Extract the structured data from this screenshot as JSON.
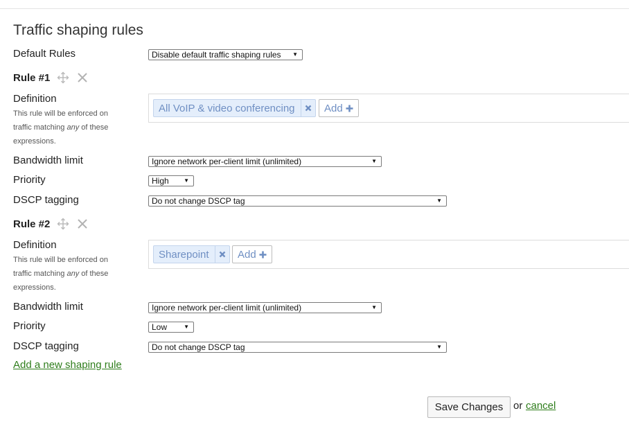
{
  "section": {
    "title": "Traffic shaping rules"
  },
  "default_rules": {
    "label": "Default Rules",
    "selected": "Disable default traffic shaping rules"
  },
  "rules": [
    {
      "title": "Rule #1",
      "definition_label": "Definition",
      "definition_help_pre": "This rule will be enforced on traffic matching ",
      "definition_help_em": "any",
      "definition_help_post": " of these expressions.",
      "tag": "All VoIP & video conferencing",
      "add_label": "Add",
      "bandwidth_label": "Bandwidth limit",
      "bandwidth_value": "Ignore network per-client limit (unlimited)",
      "priority_label": "Priority",
      "priority_value": "High",
      "dscp_label": "DSCP tagging",
      "dscp_value": "Do not change DSCP tag"
    },
    {
      "title": "Rule #2",
      "definition_label": "Definition",
      "definition_help_pre": "This rule will be enforced on traffic matching ",
      "definition_help_em": "any",
      "definition_help_post": " of these expressions.",
      "tag": "Sharepoint",
      "add_label": "Add",
      "bandwidth_label": "Bandwidth limit",
      "bandwidth_value": "Ignore network per-client limit (unlimited)",
      "priority_label": "Priority",
      "priority_value": "Low",
      "dscp_label": "DSCP tagging",
      "dscp_value": "Do not change DSCP tag"
    }
  ],
  "add_rule_link": "Add a new shaping rule",
  "footer": {
    "save_label": "Save Changes",
    "or_text": "or",
    "cancel_label": "cancel"
  },
  "icons": {
    "move": "move-arrows-icon",
    "delete": "close-x-icon",
    "tag_remove": "remove-tag-icon",
    "add": "plus-icon"
  },
  "colors": {
    "link_green": "#2e7d1b",
    "tag_blue": "#6f8fc3",
    "tag_bg": "#e4eefb"
  }
}
